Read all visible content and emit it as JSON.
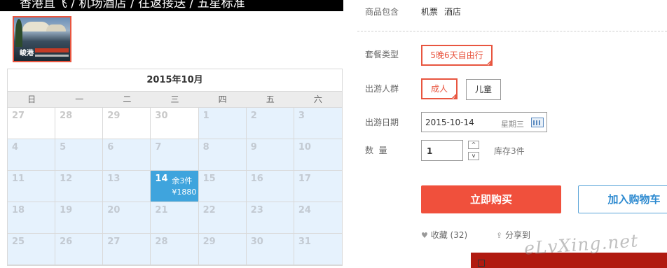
{
  "title_strip": "香港直飞 / 机场酒店 / 往返接送 / 五星标准",
  "thumbnail": {
    "logo_text": "峻港"
  },
  "calendar": {
    "month_title": "2015年10月",
    "weekdays": [
      "日",
      "一",
      "二",
      "三",
      "四",
      "五",
      "六"
    ],
    "weeks": [
      [
        {
          "d": "27",
          "prev": true
        },
        {
          "d": "28",
          "prev": true
        },
        {
          "d": "29",
          "prev": true
        },
        {
          "d": "30",
          "prev": true
        },
        {
          "d": "1"
        },
        {
          "d": "2"
        },
        {
          "d": "3"
        }
      ],
      [
        {
          "d": "4"
        },
        {
          "d": "5"
        },
        {
          "d": "6"
        },
        {
          "d": "7"
        },
        {
          "d": "8"
        },
        {
          "d": "9"
        },
        {
          "d": "10"
        }
      ],
      [
        {
          "d": "11"
        },
        {
          "d": "12"
        },
        {
          "d": "13"
        },
        {
          "d": "14",
          "selected": true,
          "stock": "余3件",
          "price": "¥1880"
        },
        {
          "d": "15"
        },
        {
          "d": "16"
        },
        {
          "d": "17"
        }
      ],
      [
        {
          "d": "18"
        },
        {
          "d": "19"
        },
        {
          "d": "20"
        },
        {
          "d": "21"
        },
        {
          "d": "22"
        },
        {
          "d": "23"
        },
        {
          "d": "24"
        }
      ],
      [
        {
          "d": "25"
        },
        {
          "d": "26"
        },
        {
          "d": "27"
        },
        {
          "d": "28"
        },
        {
          "d": "29"
        },
        {
          "d": "30"
        },
        {
          "d": "31"
        }
      ]
    ]
  },
  "package": {
    "includes_label": "商品包含",
    "includes_items": [
      "机票",
      "酒店"
    ],
    "type_label": "套餐类型",
    "type_option": "5晚6天自由行",
    "people_label": "出游人群",
    "people_options": [
      "成人",
      "儿童"
    ],
    "date_label": "出游日期",
    "date_value": "2015-10-14",
    "date_weekday": "星期三",
    "qty_label": "数  量",
    "qty_value": "1",
    "stock_text": "库存3件"
  },
  "actions": {
    "buy_now": "立即购买",
    "add_cart": "加入购物车",
    "favorite": "收藏 (32)",
    "share": "分享到"
  },
  "watermark": "eLvXing.net",
  "colors": {
    "accent": "#f0503c",
    "selected_date": "#3fa4dd",
    "cart_border": "#5aa4d8"
  }
}
